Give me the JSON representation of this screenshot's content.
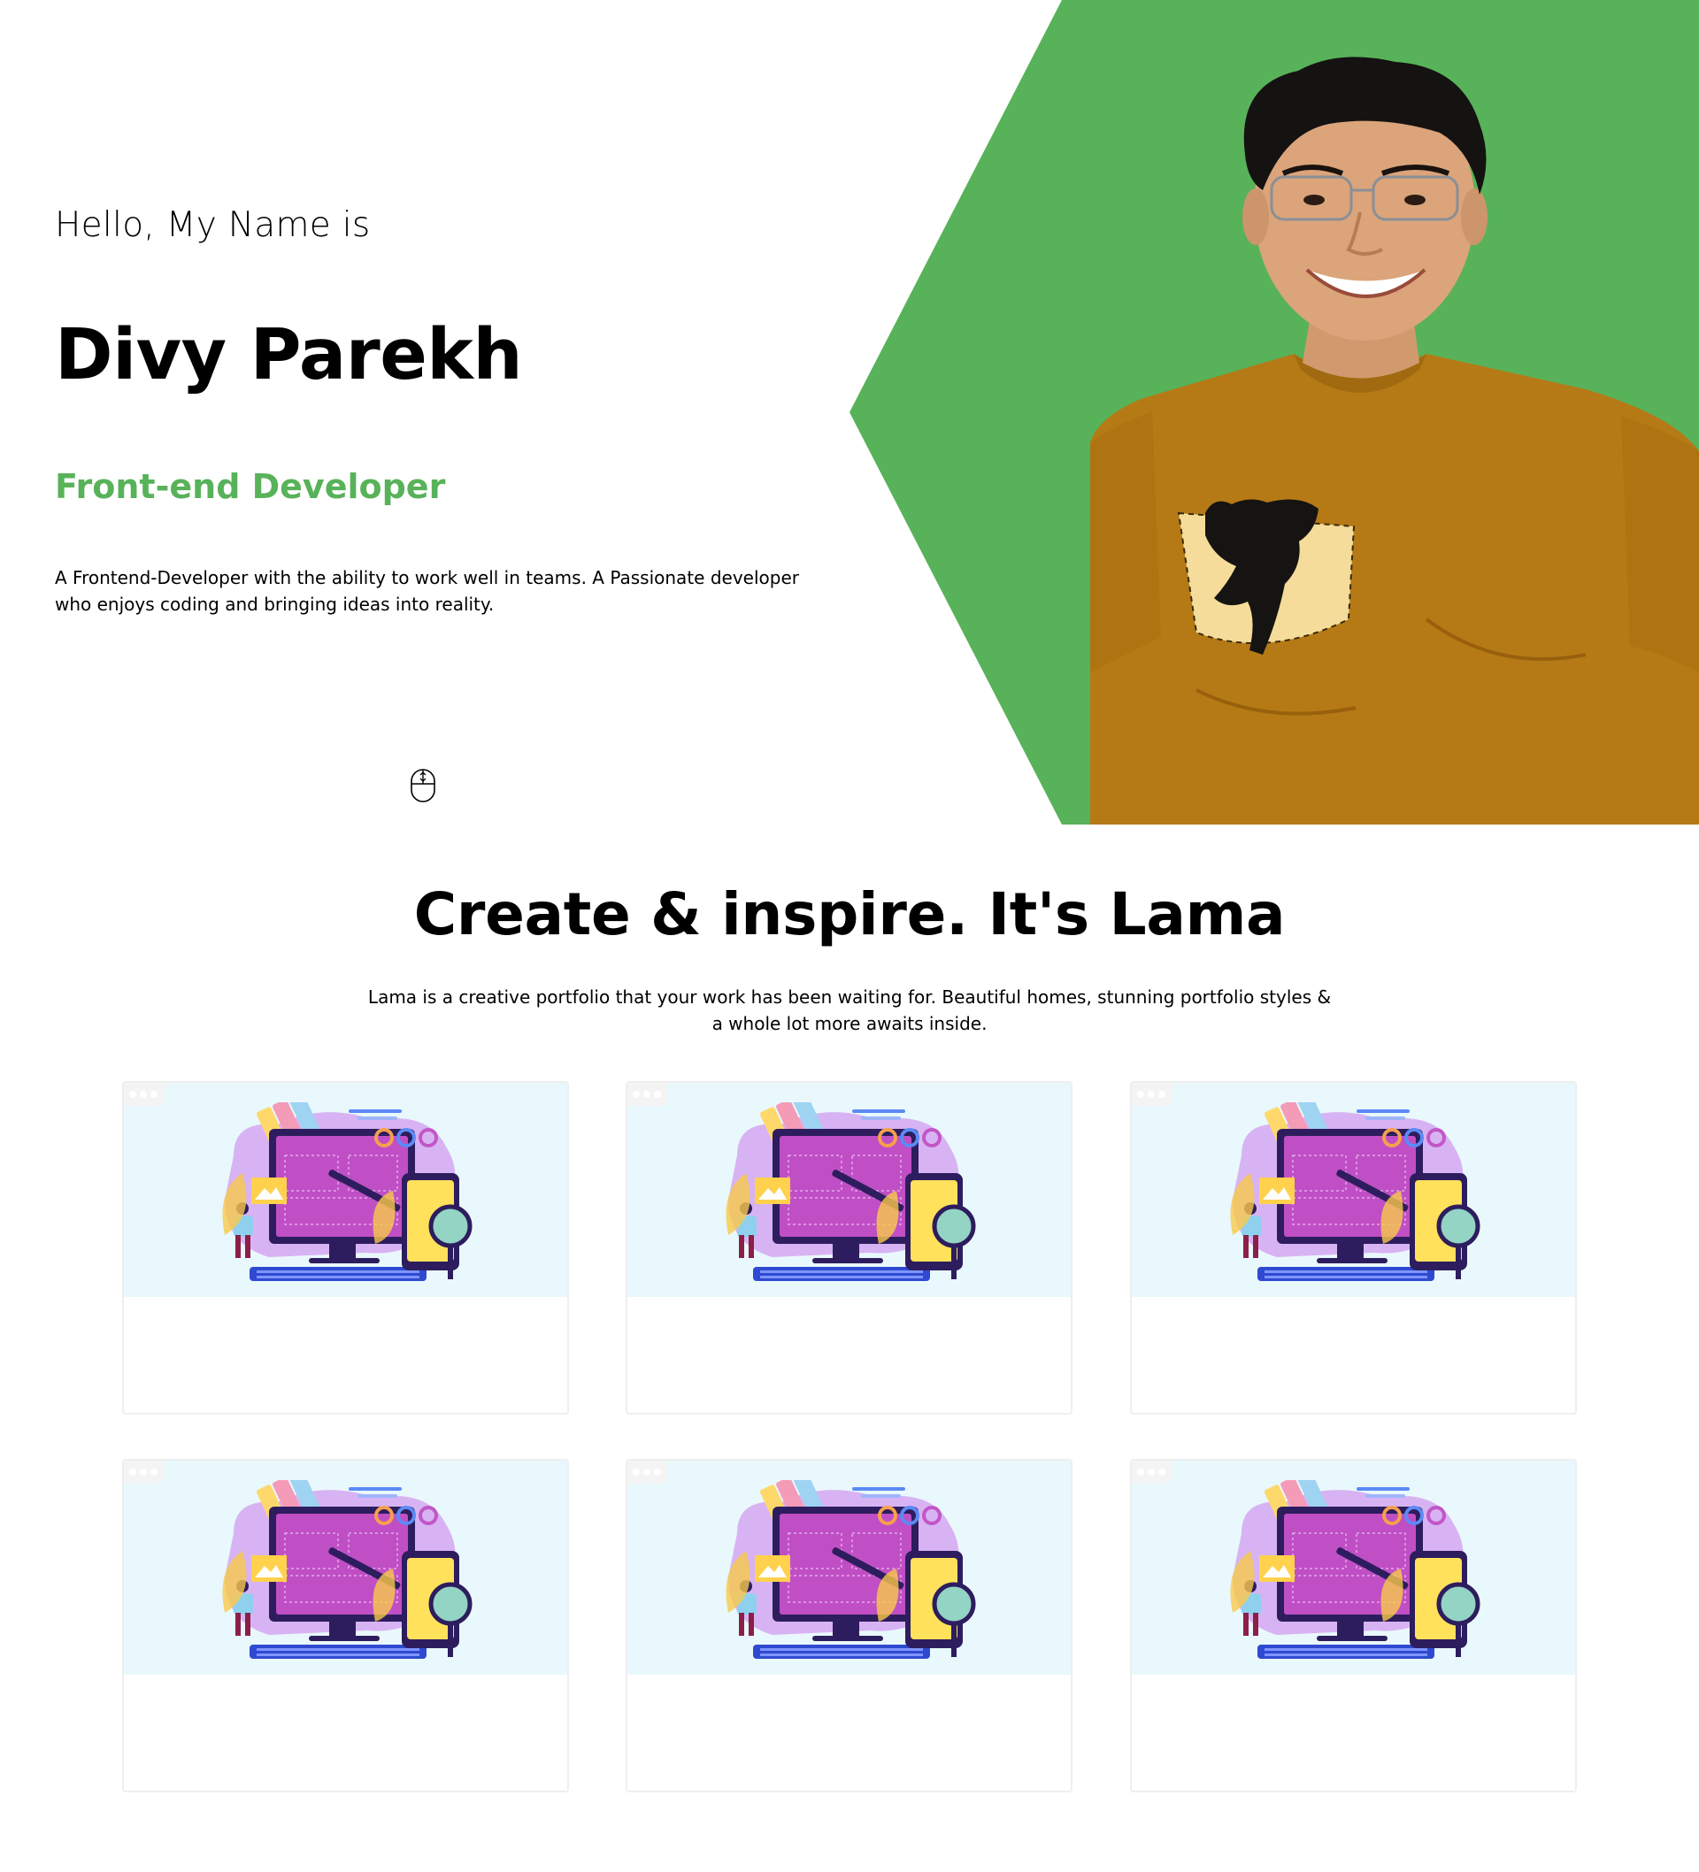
{
  "hero": {
    "intro": "Hello, My Name is",
    "name": "Divy Parekh",
    "role": "Front-end Developer",
    "description": "A Frontend-Developer with the ability to work well in teams. A Passionate developer who enjoys coding and bringing ideas into reality.",
    "scroll_icon": "mouse-scroll-icon",
    "portrait_alt": "portrait photo"
  },
  "about": {
    "title": "Create & inspire. It's Lama",
    "description": "Lama is a creative portfolio that your work has been waiting for. Beautiful homes, stunning portfolio styles & a whole lot more awaits inside."
  },
  "projects": [
    {
      "illustration": "web-design-illustration"
    },
    {
      "illustration": "web-design-illustration"
    },
    {
      "illustration": "web-design-illustration"
    },
    {
      "illustration": "web-design-illustration"
    },
    {
      "illustration": "web-design-illustration"
    },
    {
      "illustration": "web-design-illustration"
    }
  ],
  "colors": {
    "accent": "#58b259",
    "card_bg": "#e9f8fc",
    "text": "#000000"
  }
}
